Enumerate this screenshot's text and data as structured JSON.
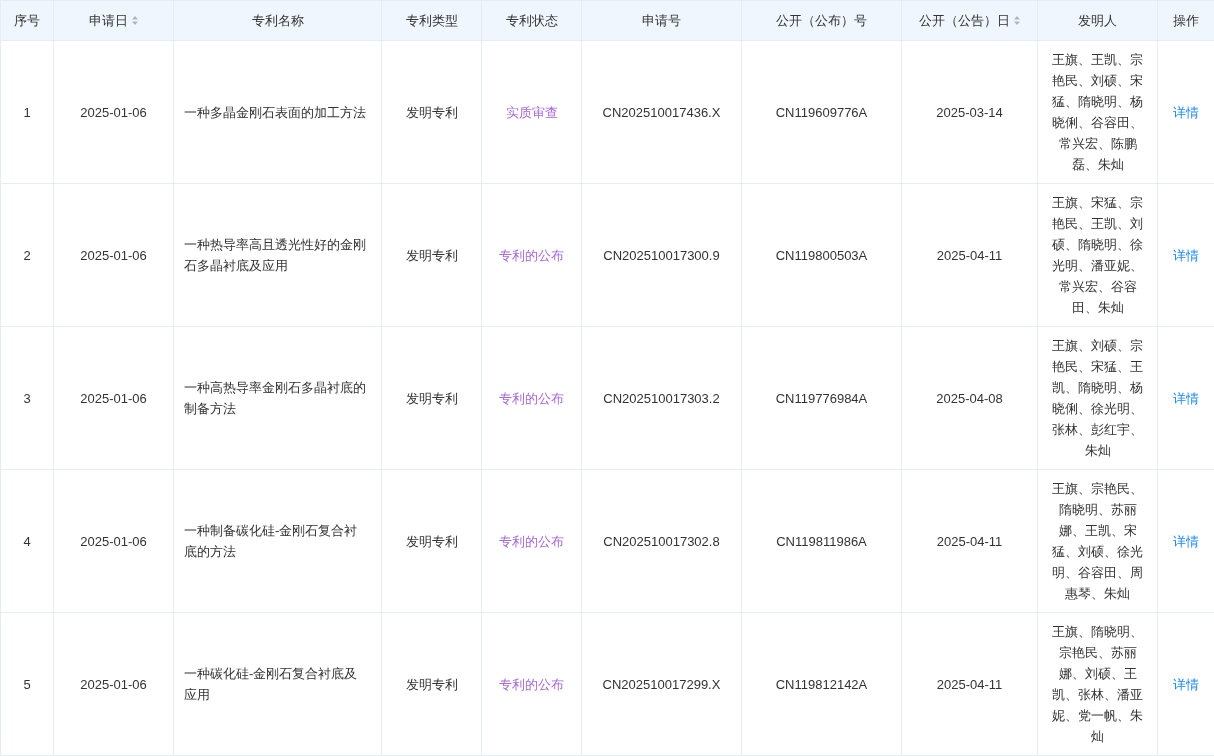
{
  "table": {
    "columns": [
      {
        "label": "序号",
        "sortable": false
      },
      {
        "label": "申请日",
        "sortable": true
      },
      {
        "label": "专利名称",
        "sortable": false
      },
      {
        "label": "专利类型",
        "sortable": false
      },
      {
        "label": "专利状态",
        "sortable": false
      },
      {
        "label": "申请号",
        "sortable": false
      },
      {
        "label": "公开（公布）号",
        "sortable": false
      },
      {
        "label": "公开（公告）日",
        "sortable": true
      },
      {
        "label": "发明人",
        "sortable": false
      },
      {
        "label": "操作",
        "sortable": false
      }
    ],
    "rows": [
      {
        "index": "1",
        "date": "2025-01-06",
        "name": "一种多晶金刚石表面的加工方法",
        "type": "发明专利",
        "status": "实质审查",
        "app_no": "CN202510017436.X",
        "pub_no": "CN119609776A",
        "pub_date": "2025-03-14",
        "inventors": "王旗、王凯、宗艳民、刘硕、宋猛、隋晓明、杨晓俐、谷容田、常兴宏、陈鹏磊、朱灿",
        "action": "详情"
      },
      {
        "index": "2",
        "date": "2025-01-06",
        "name": "一种热导率高且透光性好的金刚石多晶衬底及应用",
        "type": "发明专利",
        "status": "专利的公布",
        "app_no": "CN202510017300.9",
        "pub_no": "CN119800503A",
        "pub_date": "2025-04-11",
        "inventors": "王旗、宋猛、宗艳民、王凯、刘硕、隋晓明、徐光明、潘亚妮、常兴宏、谷容田、朱灿",
        "action": "详情"
      },
      {
        "index": "3",
        "date": "2025-01-06",
        "name": "一种高热导率金刚石多晶衬底的制备方法",
        "type": "发明专利",
        "status": "专利的公布",
        "app_no": "CN202510017303.2",
        "pub_no": "CN119776984A",
        "pub_date": "2025-04-08",
        "inventors": "王旗、刘硕、宗艳民、宋猛、王凯、隋晓明、杨晓俐、徐光明、张林、彭红宇、朱灿",
        "action": "详情"
      },
      {
        "index": "4",
        "date": "2025-01-06",
        "name": "一种制备碳化硅-金刚石复合衬底的方法",
        "type": "发明专利",
        "status": "专利的公布",
        "app_no": "CN202510017302.8",
        "pub_no": "CN119811986A",
        "pub_date": "2025-04-11",
        "inventors": "王旗、宗艳民、隋晓明、苏丽娜、王凯、宋猛、刘硕、徐光明、谷容田、周惠琴、朱灿",
        "action": "详情"
      },
      {
        "index": "5",
        "date": "2025-01-06",
        "name": "一种碳化硅-金刚石复合衬底及应用",
        "type": "发明专利",
        "status": "专利的公布",
        "app_no": "CN202510017299.X",
        "pub_no": "CN119812142A",
        "pub_date": "2025-04-11",
        "inventors": "王旗、隋晓明、宗艳民、苏丽娜、刘硕、王凯、张林、潘亚妮、党一帆、朱灿",
        "action": "详情"
      }
    ]
  }
}
